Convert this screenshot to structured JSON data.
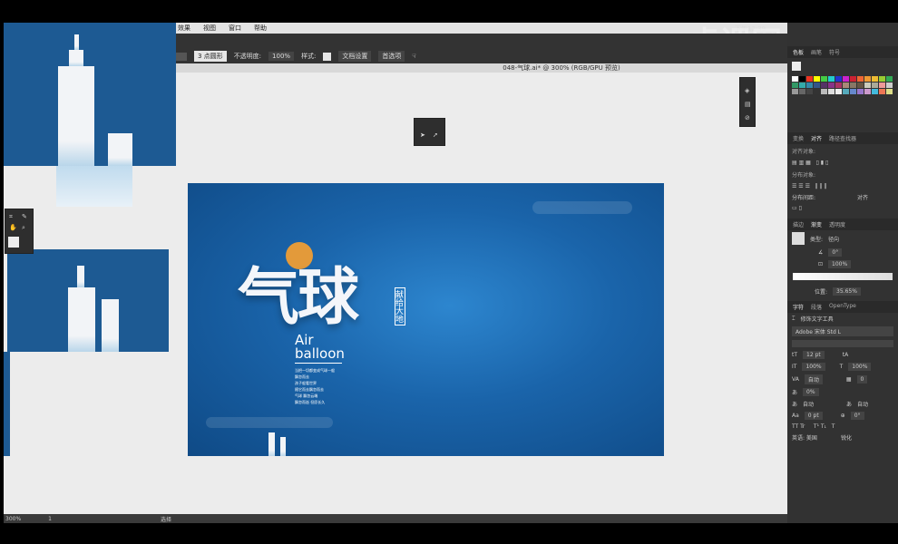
{
  "menu": [
    "效果",
    "视图",
    "窗口",
    "帮助"
  ],
  "control": {
    "brush": "3 点圆形",
    "opacity_label": "不透明度:",
    "opacity": "100%",
    "style_label": "样式:",
    "doc_setup": "文档设置",
    "prefs": "首选项"
  },
  "doc_tab": "048-气球.ai* @ 300% (RGB/GPU 预览)",
  "system": {
    "time": "下午12:39",
    "watermark": "虎课网"
  },
  "artwork": {
    "title": "气球",
    "vertical": "献给大地",
    "en1": "Air",
    "en2": "balloon",
    "lines": [
      "当把一切都变成气球一般",
      "飘忽而去",
      "孩子般看世界",
      "随它而去飘忽而去",
      "气球 飘忽云端",
      "飘忽而逝 但愿长久"
    ]
  },
  "panels": {
    "swatches_tabs": [
      "色板",
      "画笔",
      "符号"
    ],
    "align_tabs": [
      "变换",
      "对齐",
      "路径查找器"
    ],
    "align_objects": "对齐对象:",
    "distribute_objects": "分布对象:",
    "distribute_spacing": "分布间距:",
    "align_to": "对齐",
    "gradient_tabs": [
      "描边",
      "渐变",
      "透明度"
    ],
    "gradient_type_label": "类型:",
    "gradient_type": "径向",
    "angle": "0°",
    "ratio": "100%",
    "location_label": "位置:",
    "location": "35.65%",
    "char_tabs": [
      "字符",
      "段落",
      "OpenType"
    ],
    "touch_tool": "修饰文字工具",
    "font": "Adobe 宋体 Std L",
    "size": "12 pt",
    "vscale": "100%",
    "hscale": "100%",
    "leading": "自动",
    "kerning": "0",
    "tracking": "0%",
    "auto1": "自动",
    "auto2": "自动",
    "baseline": "0 pt",
    "rotate": "0°",
    "language": "英语: 美国",
    "sharp": "锐化"
  },
  "status": {
    "zoom": "300%",
    "page": "1",
    "tool": "选择"
  },
  "colors": {
    "accent": "#1a64aa",
    "sun": "#e39a3a"
  }
}
